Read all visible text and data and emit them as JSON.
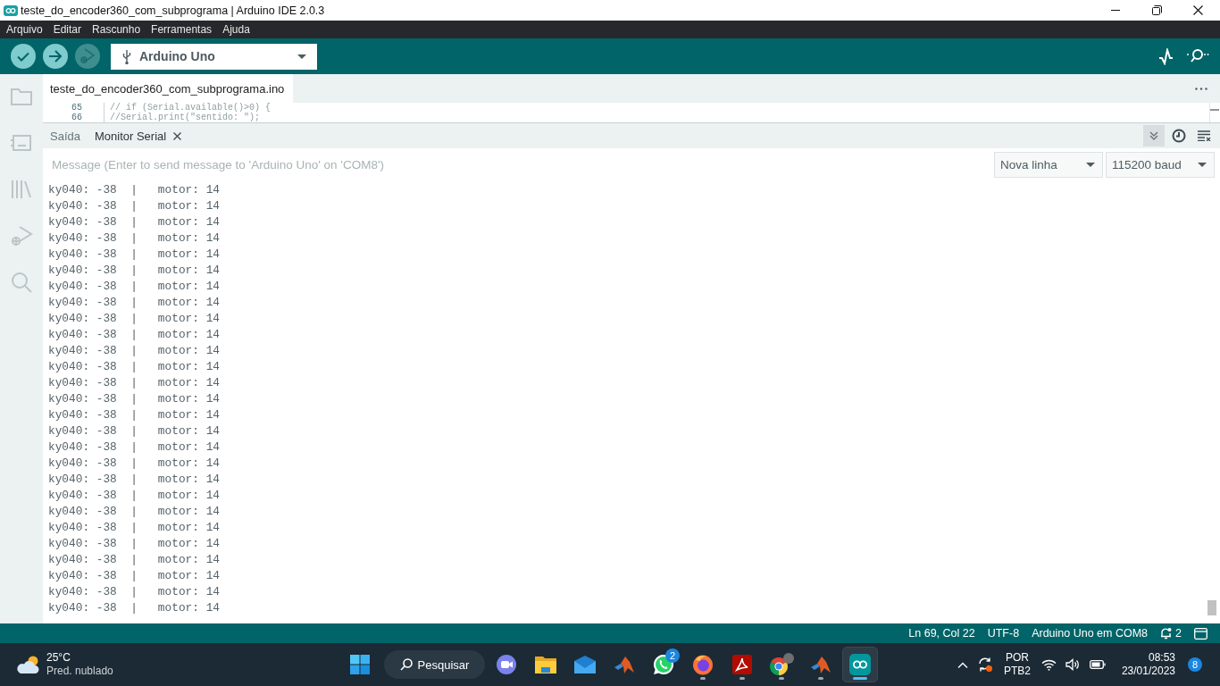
{
  "window": {
    "title": "teste_do_encoder360_com_subprograma | Arduino IDE 2.0.3"
  },
  "menu": [
    "Arquivo",
    "Editar",
    "Rascunho",
    "Ferramentas",
    "Ajuda"
  ],
  "toolbar": {
    "buttons": [
      {
        "kind": "verify",
        "disabled": false
      },
      {
        "kind": "upload",
        "disabled": false
      },
      {
        "kind": "debug",
        "disabled": true
      }
    ],
    "board": "Arduino Uno"
  },
  "editor": {
    "tabs": [
      {
        "label": "teste_do_encoder360_com_subprograma.ino",
        "selected": true
      }
    ],
    "lines": [
      {
        "number": "65",
        "code": "// if (Serial.available()>0) {"
      },
      {
        "number": "66",
        "code": "//Serial.print(\"sentido: \");"
      }
    ]
  },
  "panel": {
    "tabs": [
      {
        "label": "Saída",
        "selected": false,
        "closable": false
      },
      {
        "label": "Monitor Serial",
        "selected": true,
        "closable": true
      }
    ],
    "toggles": [
      {
        "kind": "autoscroll",
        "on": true
      },
      {
        "kind": "timestamp",
        "on": false
      }
    ],
    "message": {
      "placeholder": "Message (Enter to send message to 'Arduino Uno' on 'COM8')"
    },
    "line_ending": "Nova linha",
    "baud_rate": "115200 baud",
    "output": [
      "ky040: -38  |   motor: 14",
      "ky040: -38  |   motor: 14",
      "ky040: -38  |   motor: 14",
      "ky040: -38  |   motor: 14",
      "ky040: -38  |   motor: 14",
      "ky040: -38  |   motor: 14",
      "ky040: -38  |   motor: 14",
      "ky040: -38  |   motor: 14",
      "ky040: -38  |   motor: 14",
      "ky040: -38  |   motor: 14",
      "ky040: -38  |   motor: 14",
      "ky040: -38  |   motor: 14",
      "ky040: -38  |   motor: 14",
      "ky040: -38  |   motor: 14",
      "ky040: -38  |   motor: 14",
      "ky040: -38  |   motor: 14",
      "ky040: -38  |   motor: 14",
      "ky040: -38  |   motor: 14",
      "ky040: -38  |   motor: 14",
      "ky040: -38  |   motor: 14",
      "ky040: -38  |   motor: 14",
      "ky040: -38  |   motor: 14",
      "ky040: -38  |   motor: 14",
      "ky040: -38  |   motor: 14",
      "ky040: -38  |   motor: 14",
      "ky040: -38  |   motor: 14",
      "ky040: -38  |   motor: 14"
    ]
  },
  "status_bar": {
    "cursor": "Ln 69, Col 22",
    "encoding": "UTF-8",
    "connection": "Arduino Uno em COM8",
    "notifications": "2"
  },
  "taskbar": {
    "weather": {
      "temperature": "25°C",
      "forecast": "Pred. nublado"
    },
    "search": "Pesquisar",
    "apps": [
      {
        "kind": "chat",
        "running": false,
        "selected": false
      },
      {
        "kind": "folder",
        "running": false,
        "selected": false
      },
      {
        "kind": "mail",
        "running": false,
        "selected": false
      },
      {
        "kind": "matlab",
        "running": false,
        "selected": false
      },
      {
        "kind": "whatsapp",
        "running": false,
        "selected": false,
        "badge": "2"
      },
      {
        "kind": "firefox",
        "running": true,
        "selected": false
      },
      {
        "kind": "acrobat",
        "running": true,
        "selected": false
      },
      {
        "kind": "chrome",
        "running": true,
        "selected": false
      },
      {
        "kind": "matlab",
        "running": true,
        "selected": false
      },
      {
        "kind": "arduino",
        "running": true,
        "selected": true
      }
    ],
    "tray": {
      "language": "POR",
      "layout": "PTB2",
      "time": "08:53",
      "date": "23/01/2023",
      "notifications": "8"
    }
  }
}
